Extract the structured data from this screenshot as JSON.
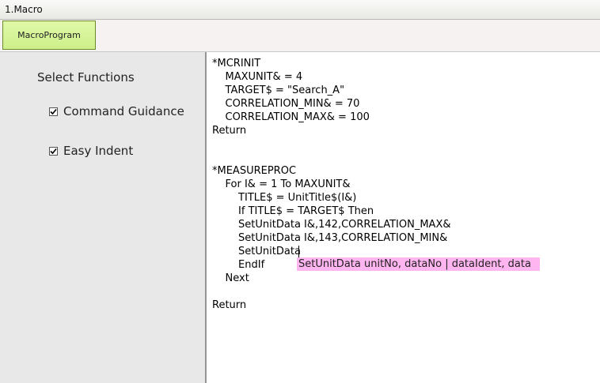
{
  "window": {
    "title": "1.Macro"
  },
  "tabs": [
    {
      "label": "MacroProgram",
      "active": true
    }
  ],
  "left_panel": {
    "section_title": "Select Functions",
    "options": [
      {
        "label": "Command Guidance",
        "checked": true
      },
      {
        "label": "Easy Indent",
        "checked": true
      }
    ]
  },
  "editor": {
    "lines": [
      "*MCRINIT",
      "    MAXUNIT& = 4",
      "    TARGET$ = \"Search_A\"",
      "    CORRELATION_MIN& = 70",
      "    CORRELATION_MAX& = 100",
      "Return",
      "",
      "",
      "*MEASUREPROC",
      "    For I& = 1 To MAXUNIT&",
      "        TITLE$ = UnitTitle$(I&)",
      "        If TITLE$ = TARGET$ Then",
      "        SetUnitData I&,142,CORRELATION_MAX&",
      "        SetUnitData I&,143,CORRELATION_MIN&",
      "        SetUnitData",
      "        EndIf",
      "    Next",
      "",
      "Return"
    ]
  },
  "tooltip": {
    "text": "SetUnitData unitNo, dataNo | dataIdent, data"
  },
  "colors": {
    "tab_active_bg": "#cdf08a",
    "tooltip_bg": "#ffb5f0",
    "panel_bg": "#e8e8e8"
  }
}
